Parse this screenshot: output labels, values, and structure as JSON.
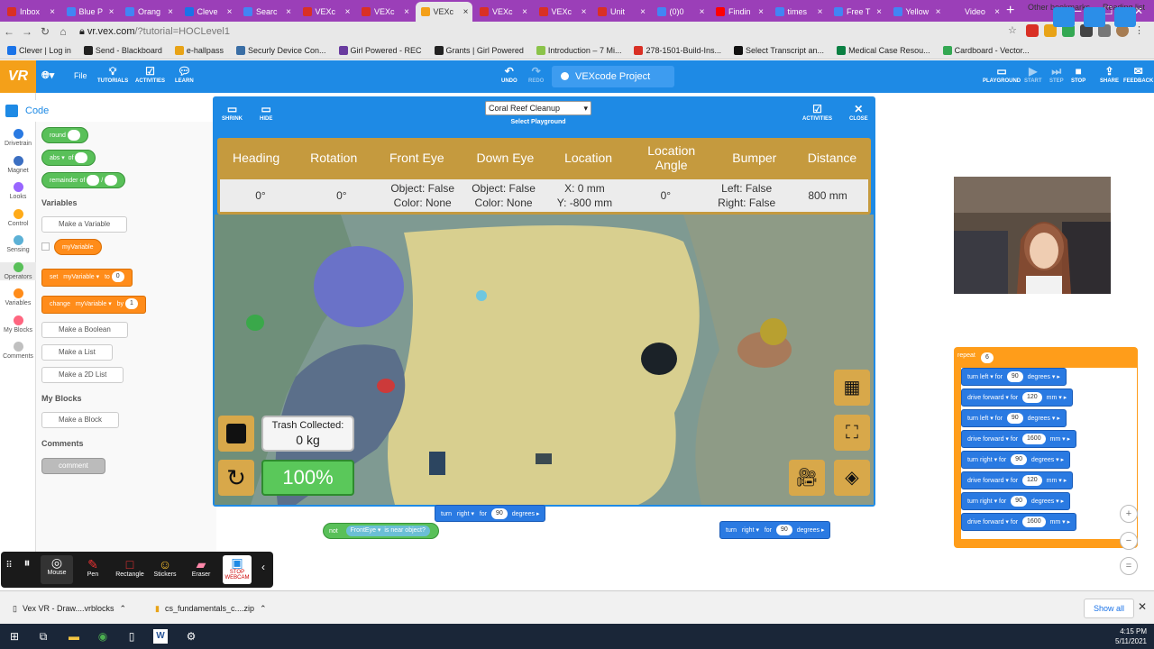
{
  "browser": {
    "tabs": [
      {
        "label": "Inbox",
        "color": "#d93025"
      },
      {
        "label": "Blue P",
        "color": "#4285f4"
      },
      {
        "label": "Orang",
        "color": "#4285f4"
      },
      {
        "label": "Cleve",
        "color": "#1a73e8"
      },
      {
        "label": "Searc",
        "color": "#4285f4"
      },
      {
        "label": "VEXc",
        "color": "#d93025"
      },
      {
        "label": "VEXc",
        "color": "#d93025"
      },
      {
        "label": "VEXc",
        "color": "#f4a019"
      },
      {
        "label": "VEXc",
        "color": "#d93025"
      },
      {
        "label": "VEXc",
        "color": "#d93025"
      },
      {
        "label": "Unit",
        "color": "#d93025"
      },
      {
        "label": "(0)0",
        "color": "#4285f4"
      },
      {
        "label": "Findin",
        "color": "#ff0000"
      },
      {
        "label": "times",
        "color": "#4285f4"
      },
      {
        "label": "Free T",
        "color": "#4285f4"
      },
      {
        "label": "Yellow",
        "color": "#4285f4"
      },
      {
        "label": "Video",
        "color": "#9b3fb8"
      }
    ],
    "active_tab_index": 7,
    "url_host": "vr.vex.com",
    "url_path": "/?tutorial=HOCLevel1",
    "bookmarks": [
      "Clever | Log in",
      "Send - Blackboard",
      "e-hallpass",
      "Securly Device Con...",
      "Girl Powered - REC",
      "Grants | Girl Powered",
      "Introduction – 7 Mi...",
      "278-1501-Build-Ins...",
      "Select Transcript an...",
      "Medical Case Resou...",
      "Cardboard - Vector..."
    ],
    "other_bookmarks": "Other bookmarks",
    "reading_list": "Reading list"
  },
  "vex_header": {
    "logo": "VR",
    "file_menu": "File",
    "tutorials": "TUTORIALS",
    "activities": "ACTIVITIES",
    "learn": "LEARN",
    "undo": "UNDO",
    "redo": "REDO",
    "project_name": "VEXcode Project",
    "playground": "PLAYGROUND",
    "start": "START",
    "step": "STEP",
    "stop": "STOP",
    "share": "SHARE",
    "feedback": "FEEDBACK"
  },
  "sidebar": {
    "code_tab": "Code",
    "categories": [
      {
        "label": "Drivetrain",
        "color": "#2a7ae2"
      },
      {
        "label": "Magnet",
        "color": "#3b6fc2"
      },
      {
        "label": "Looks",
        "color": "#9966ff"
      },
      {
        "label": "Control",
        "color": "#ffab19"
      },
      {
        "label": "Sensing",
        "color": "#5cb1d6"
      },
      {
        "label": "Operators",
        "color": "#59c059"
      },
      {
        "label": "Variables",
        "color": "#ff8c1a"
      },
      {
        "label": "My Blocks",
        "color": "#ff6680"
      },
      {
        "label": "Comments",
        "color": "#c0c0c0"
      }
    ],
    "active_category": "Operators"
  },
  "palette": {
    "round": "round",
    "abs": "abs",
    "of": "of",
    "remainder_of": "remainder of",
    "slash": "/",
    "variables_heading": "Variables",
    "make_variable": "Make a Variable",
    "my_variable": "myVariable",
    "set": "set",
    "to": "to",
    "set_value": "0",
    "change": "change",
    "by": "by",
    "change_value": "1",
    "make_boolean": "Make a Boolean",
    "make_list": "Make a List",
    "make_2d_list": "Make a 2D List",
    "my_blocks_heading": "My Blocks",
    "make_block": "Make a Block",
    "comments_heading": "Comments",
    "comment": "comment"
  },
  "playground": {
    "shrink": "SHRINK",
    "hide": "HIDE",
    "selected": "Coral Reef Cleanup",
    "select_label": "Select Playground",
    "activities": "ACTIVITIES",
    "close": "CLOSE",
    "dashboard_headers": [
      "Heading",
      "Rotation",
      "Front Eye",
      "Down Eye",
      "Location",
      "Location Angle",
      "Bumper",
      "Distance"
    ],
    "dashboard_values": [
      "0°",
      "0°",
      "Object: False\nColor: None",
      "Object: False\nColor: None",
      "X: 0 mm\nY: -800 mm",
      "0°",
      "Left: False\nRight: False",
      "800 mm"
    ],
    "trash_label": "Trash Collected:",
    "trash_value": "0 kg",
    "speed": "100%"
  },
  "workspace_blocks": {
    "turn1": {
      "turn": "turn",
      "dir": "right",
      "for": "for",
      "val": "90",
      "unit": "degrees"
    },
    "not_block": {
      "not": "not",
      "sensor": "FrontEye",
      "cond": "is near object?"
    },
    "turn2": {
      "turn": "turn",
      "dir": "right",
      "for": "for",
      "val": "90",
      "unit": "degrees"
    },
    "repeat": {
      "label": "repeat",
      "count": "6"
    },
    "stack": [
      {
        "verb": "turn",
        "dir": "left",
        "for": "for",
        "val": "90",
        "unit": "degrees"
      },
      {
        "verb": "drive",
        "dir": "forward",
        "for": "for",
        "val": "120",
        "unit": "mm"
      },
      {
        "verb": "turn",
        "dir": "left",
        "for": "for",
        "val": "90",
        "unit": "degrees"
      },
      {
        "verb": "drive",
        "dir": "forward",
        "for": "for",
        "val": "1600",
        "unit": "mm"
      },
      {
        "verb": "turn",
        "dir": "right",
        "for": "for",
        "val": "90",
        "unit": "degrees"
      },
      {
        "verb": "drive",
        "dir": "forward",
        "for": "for",
        "val": "120",
        "unit": "mm"
      },
      {
        "verb": "turn",
        "dir": "right",
        "for": "for",
        "val": "90",
        "unit": "degrees"
      },
      {
        "verb": "drive",
        "dir": "forward",
        "for": "for",
        "val": "1600",
        "unit": "mm"
      }
    ]
  },
  "zoom": {
    "in": "+",
    "out": "−",
    "reset": "="
  },
  "screencastify": {
    "mouse": "Mouse",
    "pen": "Pen",
    "rectangle": "Rectangle",
    "stickers": "Stickers",
    "eraser": "Eraser",
    "stop_webcam": "STOP WEBCAM"
  },
  "downloads": [
    {
      "name": "Vex VR - Draw....vrblocks"
    },
    {
      "name": "cs_fundamentals_c....zip"
    }
  ],
  "show_all": "Show all",
  "taskbar": {
    "time": "4:15 PM",
    "date": "5/11/2021"
  }
}
